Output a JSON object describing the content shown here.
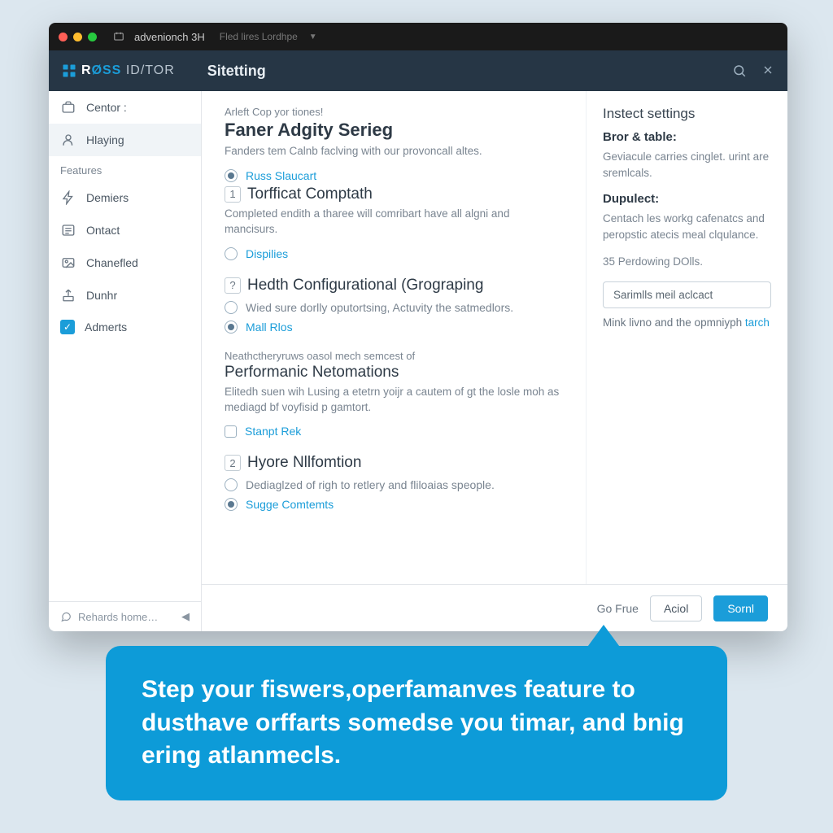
{
  "titlebar": {
    "app": "advenionch 3H",
    "sub": "Fled lires Lordhpe"
  },
  "header": {
    "brand_a": "R",
    "brand_b": "ØSS",
    "brand_c": "ID/",
    "brand_d": "TOR",
    "title": "Sitetting"
  },
  "sidebar": {
    "items": [
      {
        "label": "Centor :"
      },
      {
        "label": "Hlaying"
      }
    ],
    "features_heading": "Features",
    "features": [
      {
        "label": "Demiers"
      },
      {
        "label": "Ontact"
      },
      {
        "label": "Chanefled"
      },
      {
        "label": "Dunhr"
      },
      {
        "label": "Admerts"
      }
    ],
    "footer": "Rehards home…"
  },
  "content": {
    "eyebrow": "Arleft Cop yor tiones!",
    "h1": "Faner Adgity Serieg",
    "h1_desc": "Fanders tem Calnb faclving with our provoncall altes.",
    "h1_option": "Russ Slaucart",
    "sec1": {
      "num": "1",
      "title": "Torfficat Comptath",
      "desc": "Completed endith a tharee will comribart have all algni and mancisurs.",
      "option": "Dispilies"
    },
    "sec2": {
      "num": "?",
      "title": "Hedth Configurational (Grograping",
      "desc": "Wied sure dorlly oputortsing, Actuvity the satmedlors.",
      "option": "Mall Rlos"
    },
    "sec3": {
      "eyebrow": "Neathctheryruws oasol mech semcest of",
      "title": "Performanic Netomations",
      "desc": "Elitedh suen wih Lusing a etetrn yoijr a cautem of gt the losle moh as mediagd bf voyfisid p gamtort.",
      "option": "Stanpt Rek"
    },
    "sec4": {
      "num": "2",
      "title": "Hyore Nllfomtion",
      "desc": "Dediaglzed of righ to retlery and fliloaias speople.",
      "option": "Sugge Comtemts"
    }
  },
  "rightpane": {
    "title": "Instect settings",
    "sub1": "Bror & table:",
    "text1": "Geviacule carries cinglet. urint are sremlcals.",
    "sub2": "Dupulect:",
    "text2": "Centach les workg cafenatcs and peropstic atecis meal clqulance.",
    "text3": "35 Perdowing DOlls.",
    "button": "Sarimlls meil aclcact",
    "link": "Mink livno and the opmniyph",
    "link_accent": "tarch"
  },
  "footer": {
    "link": "Go Frue",
    "cancel": "Aciol",
    "save": "Sornl"
  },
  "callout": "Step your fiswers,operfamanves feature to dusthave orffarts somedse you timar, and bnig ering atlanmecls."
}
